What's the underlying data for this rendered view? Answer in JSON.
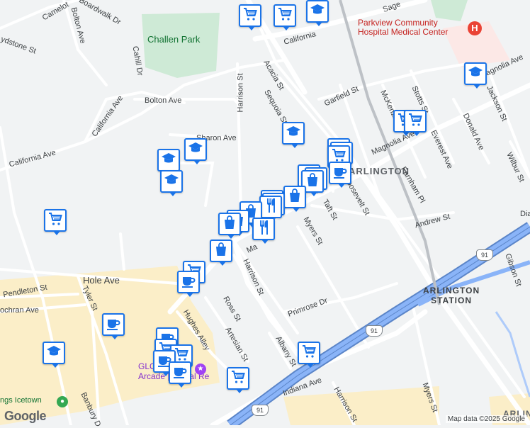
{
  "map": {
    "attribution": "Map data ©2025 Google",
    "logo_text": "Google",
    "labels": {
      "park": "Challen Park",
      "hospital_line1": "Parkview Community",
      "hospital_line2": "Hospital Medical Center",
      "district": "ARLINGTON",
      "station_line1": "ARLINGTON",
      "station_line2": "STATION",
      "arcade_line1": "GLO Mini",
      "arcade_line2": "Arcade | Virtual Re",
      "icetown": "ngs Icetown",
      "arlington_edge": "ARLIN",
      "highway_91": "91"
    },
    "streets": [
      {
        "name": "Camelot"
      },
      {
        "name": "Boardwalk Dr"
      },
      {
        "name": "Bolton Ave"
      },
      {
        "name": "ydstone St"
      },
      {
        "name": "Cahill Dr"
      },
      {
        "name": "California Ave"
      },
      {
        "name": "Bolton Ave"
      },
      {
        "name": "Sharon Ave"
      },
      {
        "name": "California Ave"
      },
      {
        "name": "Harrison St"
      },
      {
        "name": "Acacia St"
      },
      {
        "name": "Sequoia St"
      },
      {
        "name": "Garfield St"
      },
      {
        "name": "McKenzie St"
      },
      {
        "name": "Stotts St"
      },
      {
        "name": "Jackson St"
      },
      {
        "name": "Magnolia Ave"
      },
      {
        "name": "Magnolia Ave"
      },
      {
        "name": "Everest Ave"
      },
      {
        "name": "Donald Ave"
      },
      {
        "name": "Wilbur St"
      },
      {
        "name": "Farnham Pl"
      },
      {
        "name": "Roosevelt St"
      },
      {
        "name": "Taft St"
      },
      {
        "name": "Myers St"
      },
      {
        "name": "Andrew St"
      },
      {
        "name": "Gibson St"
      },
      {
        "name": "Hole Ave"
      },
      {
        "name": "Pendleton St"
      },
      {
        "name": "Tyler St"
      },
      {
        "name": "ochran Ave"
      },
      {
        "name": "Harrison St"
      },
      {
        "name": "Primrose Dr"
      },
      {
        "name": "Ross St"
      },
      {
        "name": "Hughes Alley"
      },
      {
        "name": "Artesian St"
      },
      {
        "name": "Albany St"
      },
      {
        "name": "Indiana Ave"
      },
      {
        "name": "Harrison St"
      },
      {
        "name": "Banbury D"
      },
      {
        "name": "Myers St"
      },
      {
        "name": "Sage"
      },
      {
        "name": "California"
      },
      {
        "name": "Dia"
      },
      {
        "name": "Ma"
      }
    ],
    "markers": [
      {
        "type": "cart",
        "name": "grocery-marker"
      },
      {
        "type": "cart",
        "name": "grocery-marker"
      },
      {
        "type": "school",
        "name": "school-marker"
      },
      {
        "type": "school",
        "name": "school-marker"
      },
      {
        "type": "cart",
        "name": "grocery-marker"
      },
      {
        "type": "cart",
        "name": "grocery-marker"
      },
      {
        "type": "school",
        "name": "school-marker"
      },
      {
        "type": "cart",
        "name": "grocery-marker"
      },
      {
        "type": "cart",
        "name": "grocery-marker"
      },
      {
        "type": "cart",
        "name": "grocery-marker"
      },
      {
        "type": "bag",
        "name": "shopping-marker"
      },
      {
        "type": "bag",
        "name": "shopping-marker"
      },
      {
        "type": "bag",
        "name": "shopping-marker"
      },
      {
        "type": "cup",
        "name": "cafe-marker"
      },
      {
        "type": "school",
        "name": "school-marker"
      },
      {
        "type": "school",
        "name": "school-marker"
      },
      {
        "type": "school",
        "name": "school-marker"
      },
      {
        "type": "cart",
        "name": "grocery-marker"
      },
      {
        "type": "bag",
        "name": "shopping-marker"
      },
      {
        "type": "fork",
        "name": "restaurant-marker"
      },
      {
        "type": "fork",
        "name": "restaurant-marker"
      },
      {
        "type": "fork",
        "name": "restaurant-marker"
      },
      {
        "type": "bag",
        "name": "shopping-marker"
      },
      {
        "type": "fork",
        "name": "restaurant-marker"
      },
      {
        "type": "bag",
        "name": "shopping-marker"
      },
      {
        "type": "bag",
        "name": "shopping-marker"
      },
      {
        "type": "bag",
        "name": "shopping-marker"
      },
      {
        "type": "cart",
        "name": "grocery-marker"
      },
      {
        "type": "cup",
        "name": "cafe-marker"
      },
      {
        "type": "cup",
        "name": "cafe-marker"
      },
      {
        "type": "cup",
        "name": "cafe-marker"
      },
      {
        "type": "cart",
        "name": "grocery-marker"
      },
      {
        "type": "cart",
        "name": "grocery-marker"
      },
      {
        "type": "cup",
        "name": "cafe-marker"
      },
      {
        "type": "cup",
        "name": "cafe-marker"
      },
      {
        "type": "school",
        "name": "school-marker"
      },
      {
        "type": "cart",
        "name": "grocery-marker"
      },
      {
        "type": "cart",
        "name": "grocery-marker"
      }
    ],
    "colors": {
      "background": "#f1f3f4",
      "park": "#ceead6",
      "commercial": "#fbeec8",
      "hospital_area": "#fce8e6",
      "highway": "#8ab4f8",
      "highway_casing": "#5b85c8",
      "road": "#ffffff",
      "marker_border": "#1a73e8"
    }
  }
}
